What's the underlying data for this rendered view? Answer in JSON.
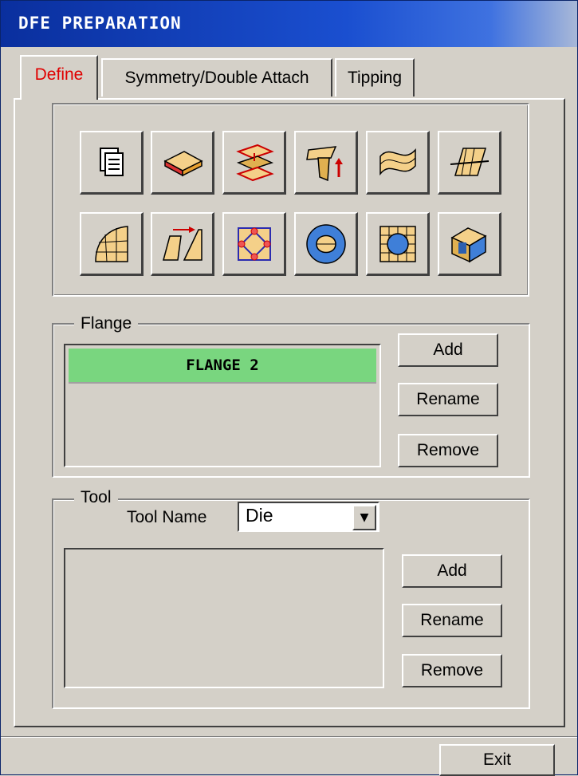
{
  "window": {
    "title": "DFE PREPARATION"
  },
  "tabs": [
    {
      "label": "Define",
      "active": true
    },
    {
      "label": "Symmetry/Double Attach",
      "active": false
    },
    {
      "label": "Tipping",
      "active": false
    }
  ],
  "toolbar_icons": [
    "copy-pages-icon",
    "layered-blank-icon",
    "stacked-sheets-icon",
    "flange-up-icon",
    "twisted-surface-icon",
    "plane-intersect-icon",
    "curved-mesh-icon",
    "shape-transform-icon",
    "boundary-nodes-icon",
    "oval-patch-icon",
    "grid-sphere-icon",
    "solid-tool-icon"
  ],
  "flange": {
    "group_label": "Flange",
    "items": [
      "FLANGE  2"
    ],
    "add_label": "Add",
    "rename_label": "Rename",
    "remove_label": "Remove"
  },
  "tool": {
    "group_label": "Tool",
    "name_label": "Tool Name",
    "name_value": "Die",
    "items": [],
    "add_label": "Add",
    "rename_label": "Rename",
    "remove_label": "Remove"
  },
  "footer": {
    "exit_label": "Exit"
  },
  "colors": {
    "title_bar": "#0a2f9e",
    "selected_item": "#79d67f",
    "active_tab_text": "#e00000",
    "face": "#d4d0c8"
  }
}
